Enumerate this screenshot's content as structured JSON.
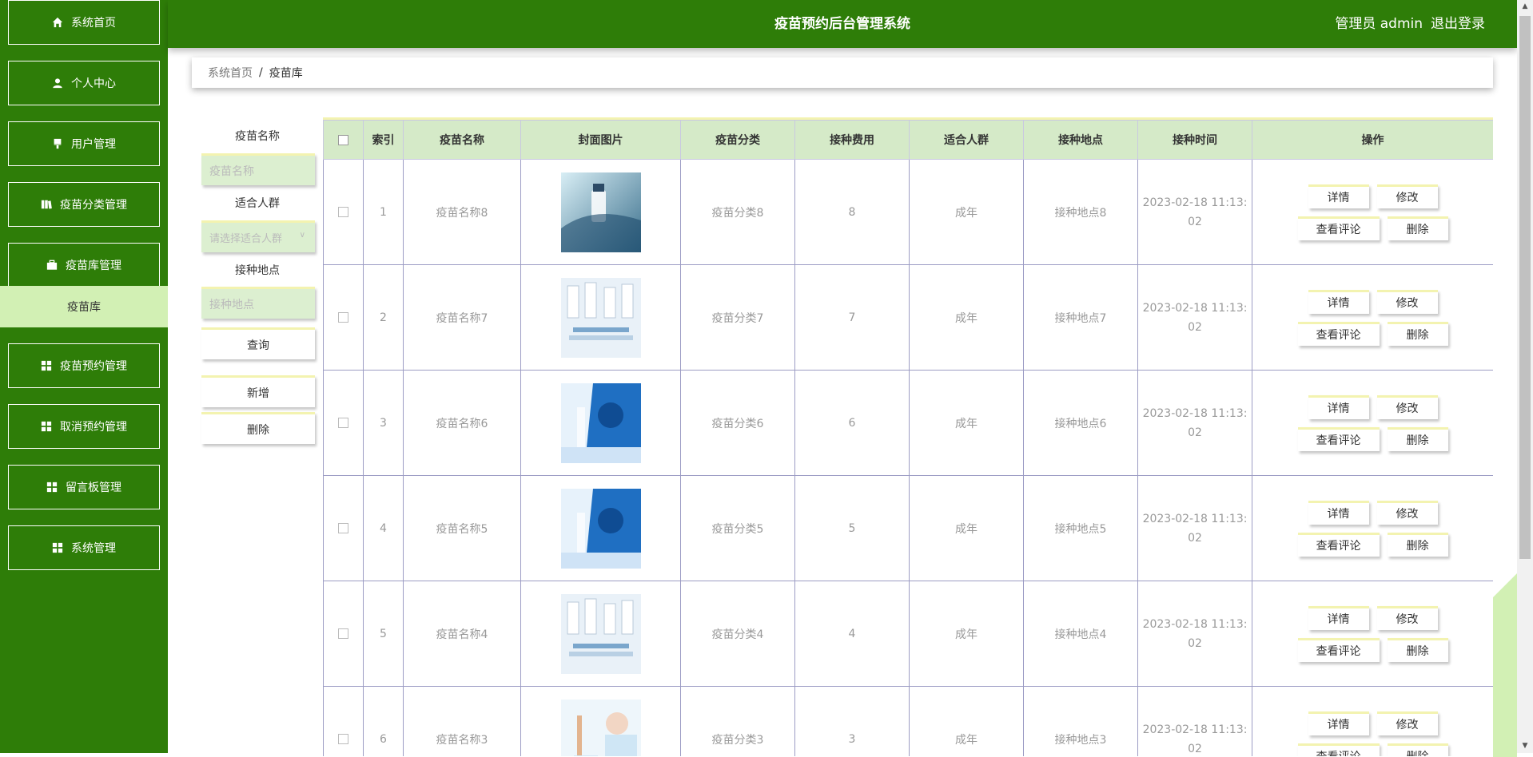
{
  "header": {
    "title": "疫苗预约后台管理系统",
    "user_label": "管理员 admin",
    "logout_label": "退出登录"
  },
  "sidebar": {
    "items": [
      {
        "label": "系统首页",
        "icon": "home-icon"
      },
      {
        "label": "个人中心",
        "icon": "user-icon"
      },
      {
        "label": "用户管理",
        "icon": "brush-icon"
      },
      {
        "label": "疫苗分类管理",
        "icon": "book-icon"
      },
      {
        "label": "疫苗库管理",
        "icon": "briefcase-icon"
      },
      {
        "label": "疫苗预约管理",
        "icon": "grid-icon"
      },
      {
        "label": "取消预约管理",
        "icon": "grid-icon"
      },
      {
        "label": "留言板管理",
        "icon": "grid-icon"
      },
      {
        "label": "系统管理",
        "icon": "grid-icon"
      }
    ],
    "active_sub": "疫苗库"
  },
  "breadcrumb": {
    "home": "系统首页",
    "sep": "/",
    "current": "疫苗库"
  },
  "search": {
    "name_label": "疫苗名称",
    "name_placeholder": "疫苗名称",
    "crowd_label": "适合人群",
    "crowd_placeholder": "请选择适合人群",
    "place_label": "接种地点",
    "place_placeholder": "接种地点",
    "query_btn": "查询",
    "add_btn": "新增",
    "delete_btn": "删除"
  },
  "table": {
    "columns": [
      "索引",
      "疫苗名称",
      "封面图片",
      "疫苗分类",
      "接种费用",
      "适合人群",
      "接种地点",
      "接种时间",
      "操作"
    ],
    "ops": {
      "detail": "详情",
      "edit": "修改",
      "comment": "查看评论",
      "delete": "删除"
    },
    "rows": [
      {
        "index": "1",
        "name": "疫苗名称8",
        "category": "疫苗分类8",
        "fee": "8",
        "crowd": "成年",
        "place": "接种地点8",
        "time1": "2023-02-18 11:13:",
        "time2": "02"
      },
      {
        "index": "2",
        "name": "疫苗名称7",
        "category": "疫苗分类7",
        "fee": "7",
        "crowd": "成年",
        "place": "接种地点7",
        "time1": "2023-02-18 11:13:",
        "time2": "02"
      },
      {
        "index": "3",
        "name": "疫苗名称6",
        "category": "疫苗分类6",
        "fee": "6",
        "crowd": "成年",
        "place": "接种地点6",
        "time1": "2023-02-18 11:13:",
        "time2": "02"
      },
      {
        "index": "4",
        "name": "疫苗名称5",
        "category": "疫苗分类5",
        "fee": "5",
        "crowd": "成年",
        "place": "接种地点5",
        "time1": "2023-02-18 11:13:",
        "time2": "02"
      },
      {
        "index": "5",
        "name": "疫苗名称4",
        "category": "疫苗分类4",
        "fee": "4",
        "crowd": "成年",
        "place": "接种地点4",
        "time1": "2023-02-18 11:13:",
        "time2": "02"
      },
      {
        "index": "6",
        "name": "疫苗名称3",
        "category": "疫苗分类3",
        "fee": "3",
        "crowd": "成年",
        "place": "接种地点3",
        "time1": "2023-02-18 11:13:",
        "time2": "02"
      }
    ]
  },
  "colors": {
    "primary": "#2e7d08",
    "active_sub": "#d2f0b4",
    "table_header": "#d5eac8",
    "input_bg": "#dcefd0"
  }
}
